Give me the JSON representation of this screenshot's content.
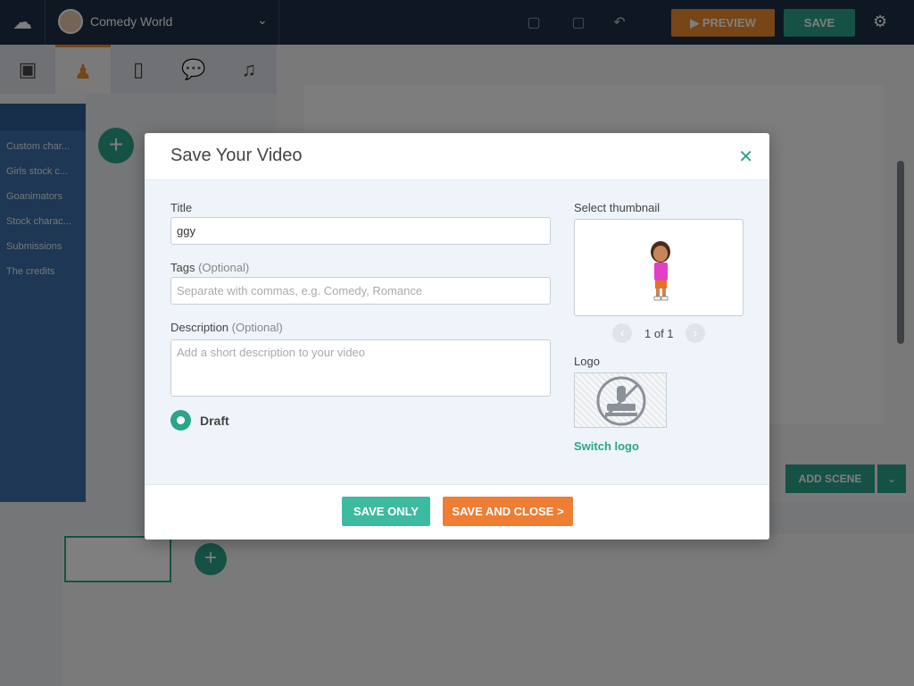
{
  "app": {
    "project_name": "Comedy World",
    "preview_label": "PREVIEW",
    "save_label": "SAVE",
    "left_nav": [
      "Custom char...",
      "Girls stock c...",
      "Goanimators",
      "Stock charac...",
      "Submissions",
      "The credits"
    ],
    "add_scene_label": "ADD SCENE"
  },
  "modal": {
    "title": "Save Your Video",
    "close_icon": "close-icon",
    "title_label": "Title",
    "title_value": "ggy",
    "tags_label": "Tags",
    "tags_optional": "(Optional)",
    "tags_placeholder": "Separate with commas, e.g. Comedy, Romance",
    "description_label": "Description",
    "description_optional": "(Optional)",
    "description_placeholder": "Add a short description to your video",
    "draft_label": "Draft",
    "thumbnail_label": "Select thumbnail",
    "pager_text": "1 of 1",
    "logo_label": "Logo",
    "switch_logo": "Switch logo",
    "save_only": "SAVE ONLY",
    "save_and_close": "SAVE AND CLOSE >"
  },
  "colors": {
    "accent_green": "#2aa58a",
    "accent_orange": "#ef7d33",
    "topbar": "#1e2e45"
  }
}
